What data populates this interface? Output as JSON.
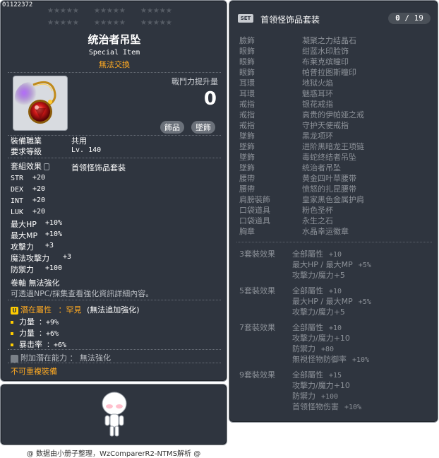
{
  "item": {
    "id": "01122372",
    "name": "统治者吊坠",
    "subtitle": "Special Item",
    "trade_status": "無法交換",
    "power_label": "戰鬥力提升量",
    "power_value": "0",
    "tags": [
      "飾品",
      "墜飾"
    ],
    "job_label": "裝備職業",
    "job_value": "共用",
    "level_label": "要求等級",
    "level_value": "Lv. 140",
    "set_label": "套組效果",
    "set_value": "首领怪饰品套装",
    "stats": [
      {
        "k": "STR",
        "v": "+20"
      },
      {
        "k": "DEX",
        "v": "+20"
      },
      {
        "k": "INT",
        "v": "+20"
      },
      {
        "k": "LUK",
        "v": "+20"
      },
      {
        "k": "最大HP",
        "v": "+10%"
      },
      {
        "k": "最大MP",
        "v": "+10%"
      },
      {
        "k": "攻擊力",
        "v": "+3"
      },
      {
        "k": "魔法攻擊力",
        "v": "+3"
      },
      {
        "k": "防禦力",
        "v": "+100"
      }
    ],
    "scroll_line": "卷軸 無法強化",
    "info_line": "可透過NPC/採集查看強化資訊詳細內容。",
    "potential_label": "潛在屬性",
    "potential_grade": "：罕見",
    "potential_note": "(無法追加強化)",
    "potential_lines": [
      {
        "k": "力量",
        "v": "：+9%"
      },
      {
        "k": "力量",
        "v": "：+6%"
      },
      {
        "k": "暴击率",
        "v": "：+6%"
      }
    ],
    "bonus_potential": "附加潛在能力 ： 無法強化",
    "unique_equip": "不可重複裝備"
  },
  "set": {
    "badge": "SET",
    "title": "首领怪饰品套装",
    "count_owned": "0",
    "count_total": "19",
    "items": [
      {
        "slot": "臉飾",
        "name": "凝聚之力结晶石"
      },
      {
        "slot": "眼飾",
        "name": "绀蓝水印脸饰"
      },
      {
        "slot": "眼飾",
        "name": "布莱克缤瞳印"
      },
      {
        "slot": "眼飾",
        "name": "帕普拉图斯瞳印"
      },
      {
        "slot": "耳環",
        "name": "地狱火焰"
      },
      {
        "slot": "耳環",
        "name": "魅惑耳环"
      },
      {
        "slot": "戒指",
        "name": "银花戒指"
      },
      {
        "slot": "戒指",
        "name": "高贵的伊帕娅之戒"
      },
      {
        "slot": "戒指",
        "name": "守护天使戒指"
      },
      {
        "slot": "墜飾",
        "name": "黑龙项环"
      },
      {
        "slot": "墜飾",
        "name": "进阶黑暗龙王项链"
      },
      {
        "slot": "墜飾",
        "name": "毒蛇终结者吊坠"
      },
      {
        "slot": "墜飾",
        "name": "统治者吊坠"
      },
      {
        "slot": "腰帶",
        "name": "黄金四叶草腰带"
      },
      {
        "slot": "腰帶",
        "name": "愤怒的扎昆腰带"
      },
      {
        "slot": "肩膀裝飾",
        "name": "皇家黑色金属护肩"
      },
      {
        "slot": "口袋道具",
        "name": "粉色圣杯"
      },
      {
        "slot": "口袋道具",
        "name": "永生之石"
      },
      {
        "slot": "胸章",
        "name": "水晶幸运徽章"
      }
    ],
    "effects": [
      {
        "label": "3套裝效果",
        "lines": [
          {
            "t": "全部屬性",
            "v": "+10"
          },
          {
            "t": "最大HP / 最大MP",
            "v": "+5%"
          },
          {
            "t": "攻擊力/魔力+5",
            "v": ""
          }
        ]
      },
      {
        "label": "5套裝效果",
        "lines": [
          {
            "t": "全部屬性",
            "v": "+10"
          },
          {
            "t": "最大HP / 最大MP",
            "v": "+5%"
          },
          {
            "t": "攻擊力/魔力+5",
            "v": ""
          }
        ]
      },
      {
        "label": "7套裝效果",
        "lines": [
          {
            "t": "全部屬性",
            "v": "+10"
          },
          {
            "t": "攻擊力/魔力+10",
            "v": ""
          },
          {
            "t": "防禦力",
            "v": "+80"
          },
          {
            "t": "無視怪物防御率",
            "v": "+10%"
          }
        ]
      },
      {
        "label": "9套裝效果",
        "lines": [
          {
            "t": "全部屬性",
            "v": "+15"
          },
          {
            "t": "攻擊力/魔力+10",
            "v": ""
          },
          {
            "t": "防禦力",
            "v": "+100"
          },
          {
            "t": "首领怪物伤害",
            "v": "+10%"
          }
        ]
      }
    ]
  },
  "footer": "@ 数据由小册子整理，WzComparerR2-NTMS解析 @"
}
